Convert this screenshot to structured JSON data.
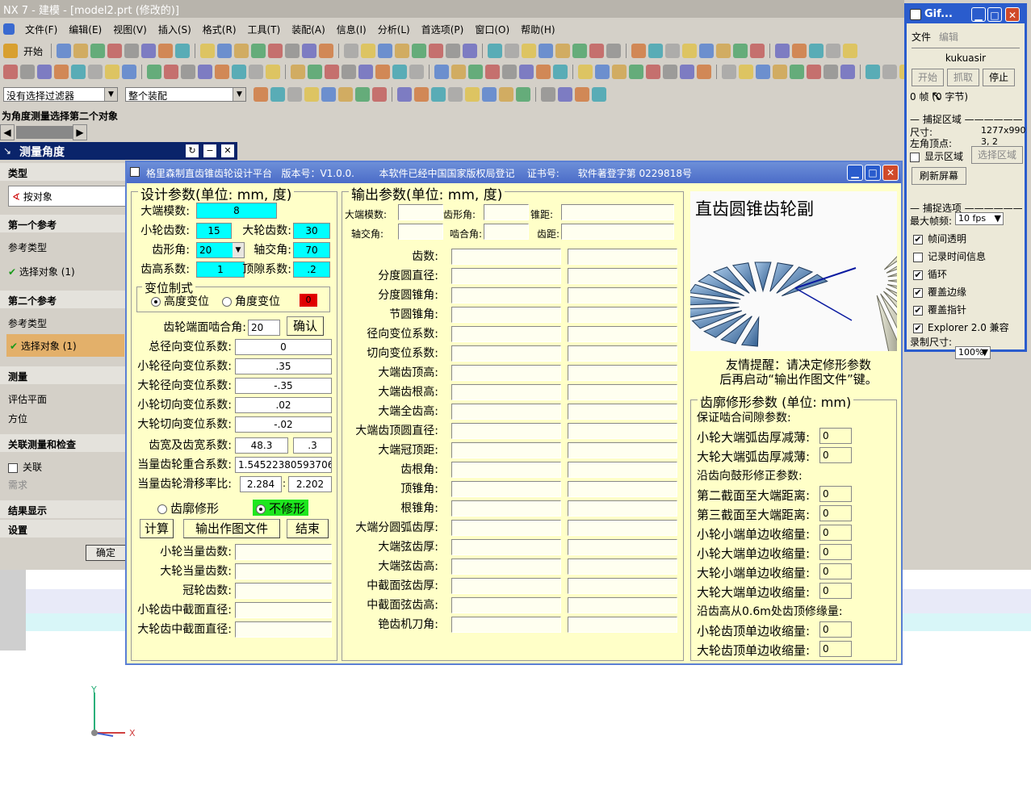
{
  "nx": {
    "title": "NX 7 - 建模 - [model2.prt (修改的)]",
    "menu": [
      "文件(F)",
      "编辑(E)",
      "视图(V)",
      "插入(S)",
      "格式(R)",
      "工具(T)",
      "装配(A)",
      "信息(I)",
      "分析(L)",
      "首选项(P)",
      "窗口(O)",
      "帮助(H)"
    ],
    "start_label": "开始",
    "filter_value": "没有选择过滤器",
    "assembly_value": "整个装配",
    "cue_line": "为角度测量选择第二个对象"
  },
  "measure": {
    "title": "测量角度",
    "type_section": "类型",
    "type_value": "按对象",
    "ref1_section": "第一个参考",
    "ref1_type_label": "参考类型",
    "ref1_select": "选择对象 (1)",
    "ref2_section": "第二个参考",
    "ref2_type_label": "参考类型",
    "ref2_select": "选择对象 (1)",
    "measure_section": "测量",
    "eval_plane": "评估平面",
    "direction": "方位",
    "assoc_section": "关联测量和检查",
    "assoc_label": "关联",
    "require_label": "需求",
    "result_section": "结果显示",
    "settings_section": "设置",
    "ok_button": "确定"
  },
  "axis": {
    "x": "X",
    "y": "Y"
  },
  "app": {
    "title": "格里森制直齿锥齿轮设计平台   版本号：V1.0.0.        本软件已经中国国家版权局登记    证书号:      软件著登字第 0229818号",
    "design_group": "设计参数(单位: mm, 度)",
    "module_label": "大端模数:",
    "module_value": "8",
    "z1_label": "小轮齿数:",
    "z1_value": "15",
    "z2_label": "大轮齿数:",
    "z2_value": "30",
    "alpha_label": "齿形角:",
    "alpha_value": "20",
    "sigma_label": "轴交角:",
    "sigma_value": "70",
    "ha_label": "齿高系数:",
    "ha_value": "1",
    "c_label": "顶隙系数:",
    "c_value": ".2",
    "shift_group": "变位制式",
    "shift_opt1": "高度变位",
    "shift_opt2": "角度变位",
    "shift_flag": "0",
    "pressure_label": "齿轮端面啮合角:",
    "pressure_value": "20",
    "confirm_button": "确认",
    "rows": [
      {
        "label": "总径向变位系数:",
        "value": "0"
      },
      {
        "label": "小轮径向变位系数:",
        "value": ".35"
      },
      {
        "label": "大轮径向变位系数:",
        "value": "-.35"
      },
      {
        "label": "小轮切向变位系数:",
        "value": ".02"
      },
      {
        "label": "大轮切向变位系数:",
        "value": "-.02"
      }
    ],
    "face_label": "齿宽及齿宽系数:",
    "face_value": "48.3",
    "face_coef": ".3",
    "contact_label": "当量齿轮重合系数:",
    "contact_value": "1.54522380593706",
    "slip_label": "当量齿轮滑移率比:",
    "slip_value1": "2.284",
    "slip_sep": ":",
    "slip_value2": "2.202",
    "profile_opt1": "齿廓修形",
    "profile_opt2": "不修形",
    "calc_button": "计算",
    "export_button": "输出作图文件",
    "end_button": "结束",
    "equiv": [
      "小轮当量齿数:",
      "大轮当量齿数:",
      "冠轮齿数:",
      "小轮齿中截面直径:",
      "大轮齿中截面直径:"
    ],
    "output_group": "输出参数(单位: mm, 度)",
    "out_top1": [
      "大端模数:",
      "齿形角:",
      "锥距:"
    ],
    "out_top2": [
      "轴交角:",
      "啮合角:",
      "齿距:"
    ],
    "out_rows": [
      "齿数:",
      "分度圆直径:",
      "分度圆锥角:",
      "节圆锥角:",
      "径向变位系数:",
      "切向变位系数:",
      "大端齿顶高:",
      "大端齿根高:",
      "大端全齿高:",
      "大端齿顶圆直径:",
      "大端冠顶距:",
      "齿根角:",
      "顶锥角:",
      "根锥角:",
      "大端分圆弧齿厚:",
      "大端弦齿厚:",
      "大端弦齿高:",
      "中截面弦齿厚:",
      "中截面弦齿高:",
      "铯齿机刀角:"
    ],
    "image_title": "直齿圆锥齿轮副",
    "hint1": "友情提醒：请决定修形参数",
    "hint2": "后再启动“输出作图文件”键。",
    "mod_group": "齿廓修形参数 (单位: mm)",
    "mod_sub1": "保证啮合间隙参数:",
    "mod_rows1": [
      {
        "label": "小轮大端弧齿厚减薄:",
        "value": "0"
      },
      {
        "label": "大轮大端弧齿厚减薄:",
        "value": "0"
      }
    ],
    "mod_sub2": "沿齿向鼓形修正参数:",
    "mod_rows2": [
      {
        "label": "第二截面至大端距离:",
        "value": "0"
      },
      {
        "label": "第三截面至大端距离:",
        "value": "0"
      },
      {
        "label": "小轮小端单边收缩量:",
        "value": "0"
      },
      {
        "label": "小轮大端单边收缩量:",
        "value": "0"
      },
      {
        "label": "大轮小端单边收缩量:",
        "value": "0"
      },
      {
        "label": "大轮大端单边收缩量:",
        "value": "0"
      }
    ],
    "mod_sub3": "沿齿高从0.6m处齿顶修缘量:",
    "mod_rows3": [
      {
        "label": "小轮齿顶单边收缩量:",
        "value": "0"
      },
      {
        "label": "大轮齿顶单边收缩量:",
        "value": "0"
      }
    ]
  },
  "gif": {
    "title": "Gif...",
    "menu_file": "文件",
    "menu_edit": "编辑",
    "user": "kukuasir",
    "start": "开始",
    "capture": "抓取",
    "stop": "停止",
    "status": "0 帧 (0 字节)",
    "capture_area": "捕捉区域",
    "size_label": "尺寸:",
    "size_value": "1277x990",
    "topleft_label": "左角顶点:",
    "topleft_value": "3, 2",
    "show_region": "显示区域",
    "select_region": "选择区域",
    "refresh": "刷新屏幕",
    "capture_opts": "捕捉选项",
    "max_fps_label": "最大帧频:",
    "max_fps_value": "10 fps",
    "opts": [
      {
        "label": "帧间透明",
        "checked": true
      },
      {
        "label": "记录时间信息",
        "checked": false
      },
      {
        "label": "循环",
        "checked": true
      },
      {
        "label": "覆盖边缘",
        "checked": true
      },
      {
        "label": "覆盖指针",
        "checked": true
      },
      {
        "label": "Explorer 2.0 兼容",
        "checked": true
      }
    ],
    "rec_size_label": "录制尺寸:",
    "rec_size_value": "100%"
  }
}
